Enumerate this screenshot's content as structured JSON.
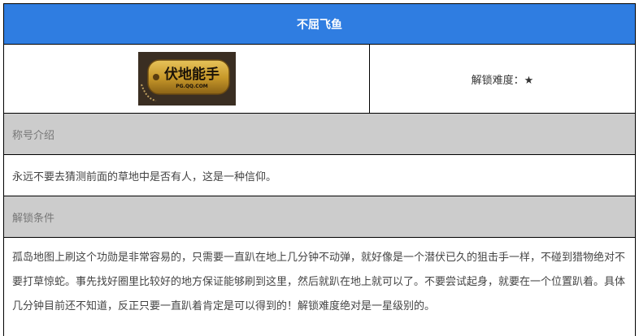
{
  "title": "不屈飞鱼",
  "difficulty_text": "解锁难度：★",
  "image": {
    "alt": "伏地能手",
    "badge_text": "伏地能手",
    "badge_subtext": "PG.QQ.COM"
  },
  "sections": {
    "intro_heading": "称号介绍",
    "intro_text": "永远不要去猜测前面的草地中是否有人，这是一种信仰。",
    "unlock_heading": "解锁条件",
    "unlock_text": "孤岛地图上刷这个功勋是非常容易的，只需要一直趴在地上几分钟不动弹，就好像是一个潜伏已久的狙击手一样，不碰到猎物绝对不要打草惊蛇。事先找好圈里比较好的地方保证能够刷到这里，然后就趴在地上就可以了。不要尝试起身，就要在一个位置趴着。具体几分钟目前还不知道，反正只要一直趴着肯定是可以得到的！解锁难度绝对是一星级别的。"
  },
  "colors": {
    "title_bar": "#2f7de1",
    "section_head": "#cccccc"
  }
}
